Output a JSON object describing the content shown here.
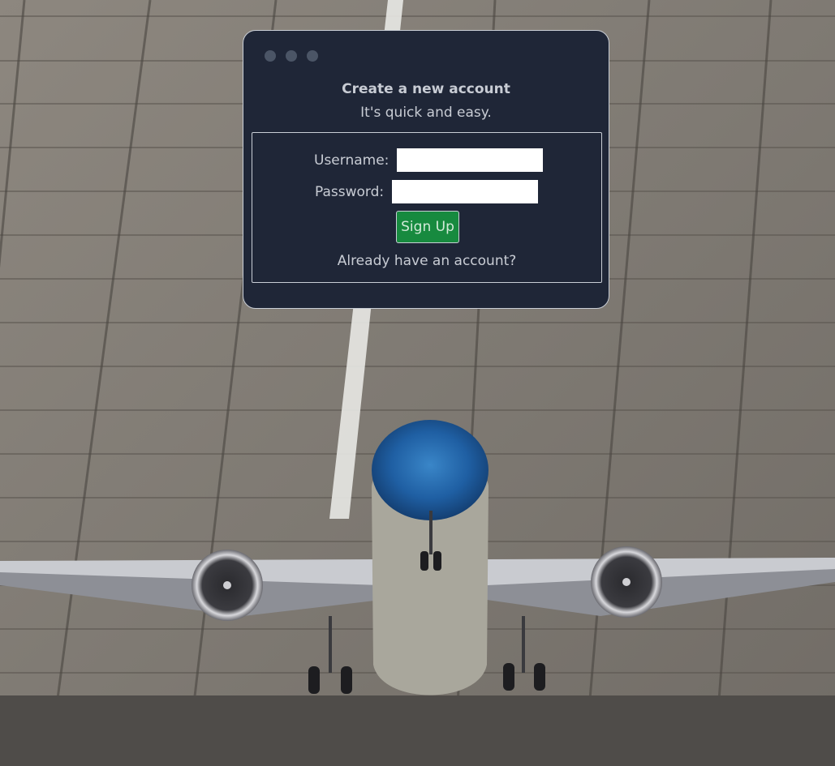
{
  "signup_window": {
    "title": "Create a new account",
    "subtitle": "It's quick and easy.",
    "username_label": "Username:",
    "username_value": "",
    "password_label": "Password:",
    "password_value": "",
    "signup_button_label": "Sign Up",
    "login_link_label": "Already have an account?"
  },
  "colors": {
    "window_background": "#1f2637",
    "signup_button": "#178a3f",
    "text": "#c8ccd4"
  }
}
